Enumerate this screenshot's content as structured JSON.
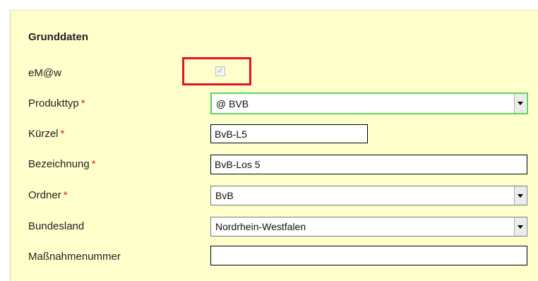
{
  "form": {
    "section_title": "Grunddaten",
    "required_marker": "*",
    "emaw": {
      "label": "eM@w",
      "checked": true,
      "check_glyph": "✓"
    },
    "produkttyp": {
      "label": "Produkttyp",
      "value": "@ BVB",
      "icon": "chevron-down-icon"
    },
    "kuerzel": {
      "label": "Kürzel",
      "value": "BvB-L5"
    },
    "bezeichnung": {
      "label": "Bezeichnung",
      "value": "BvB-Los 5"
    },
    "ordner": {
      "label": "Ordner",
      "value": "BvB",
      "icon": "chevron-down-icon"
    },
    "bundesland": {
      "label": "Bundesland",
      "value": "Nordrhein-Westfalen",
      "icon": "chevron-down-icon"
    },
    "massnahmenummer": {
      "label": "Maßnahmenummer",
      "value": ""
    }
  },
  "colors": {
    "panel_background": "#ffffcc",
    "highlight_border": "#e3141c",
    "focus_border": "#5fd35f",
    "required_marker": "#e02020"
  }
}
